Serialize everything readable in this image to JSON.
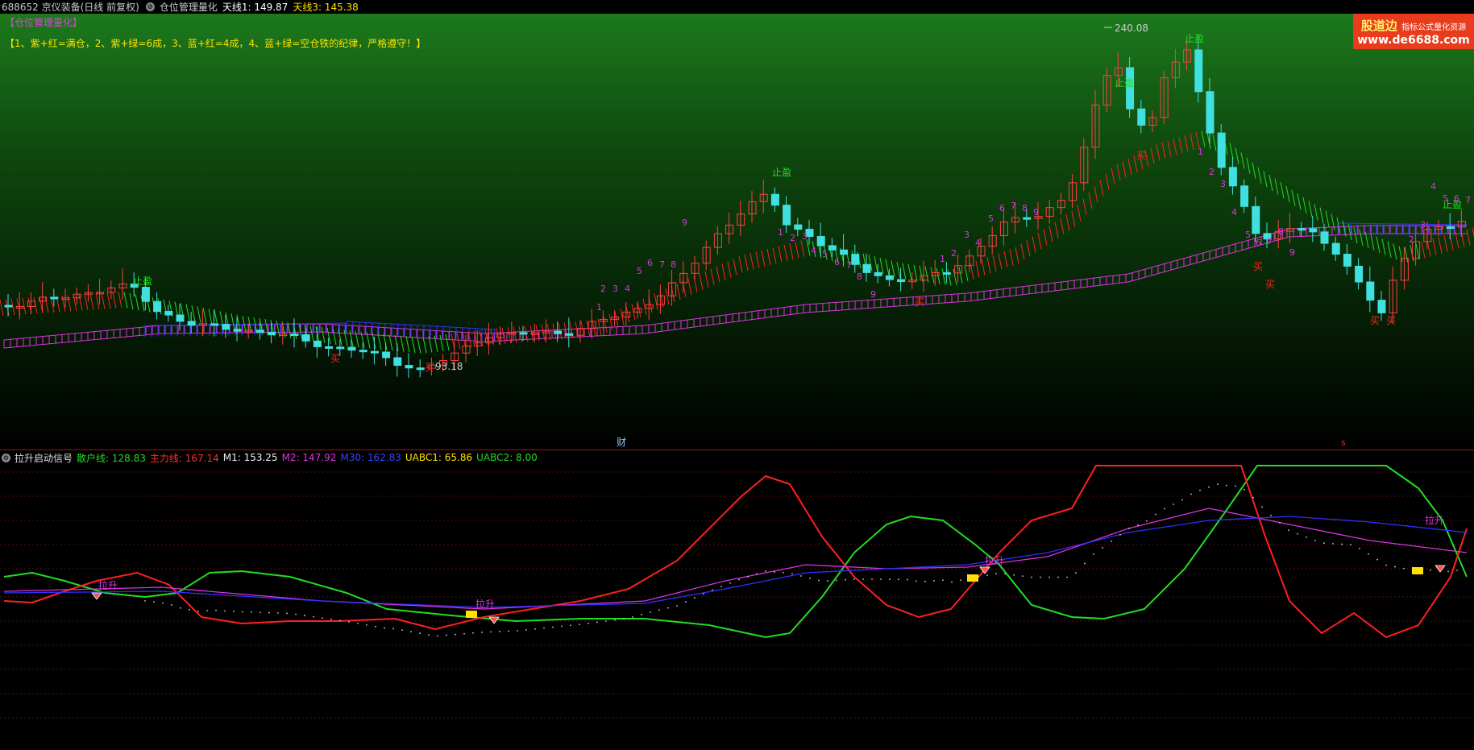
{
  "topbar": {
    "stock": "688652 京仪装备(日线 前复权)",
    "indicator": "仓位管理量化",
    "tianxian1": "天线1: 149.87",
    "tianxian3": "天线3: 145.38"
  },
  "main": {
    "title": "【仓位管理量化】",
    "rule": "【1、紫+红=满仓，2、紫+绿=6成，3、蓝+红=4成，4、蓝+绿=空仓铁的纪律，严格遵守！】",
    "high_label": "240.08",
    "low_label": "93.18",
    "bottom_marker": "财",
    "tags": {
      "zhiying": "止盈",
      "mai": "买"
    }
  },
  "logo": {
    "brand": "股道边",
    "sub": "指标公式量化资源",
    "url": "www.de6688.com"
  },
  "sub": {
    "title": "拉升启动信号",
    "sanhu": "散户线: 128.83",
    "zhuli": "主力线: 167.14",
    "m1": "M1: 153.25",
    "m2": "M2: 147.92",
    "m30": "M30: 162.83",
    "uabc1": "UABC1: 65.86",
    "uabc2": "UABC2: 8.00",
    "signal": "拉升"
  },
  "colors": {
    "up": "#ff4040",
    "down": "#40e0e0",
    "green_line": "#22dd22",
    "red_line": "#ff2020",
    "magenta": "#dd33dd",
    "blue": "#3030ff",
    "yellow": "#ffe000"
  }
}
